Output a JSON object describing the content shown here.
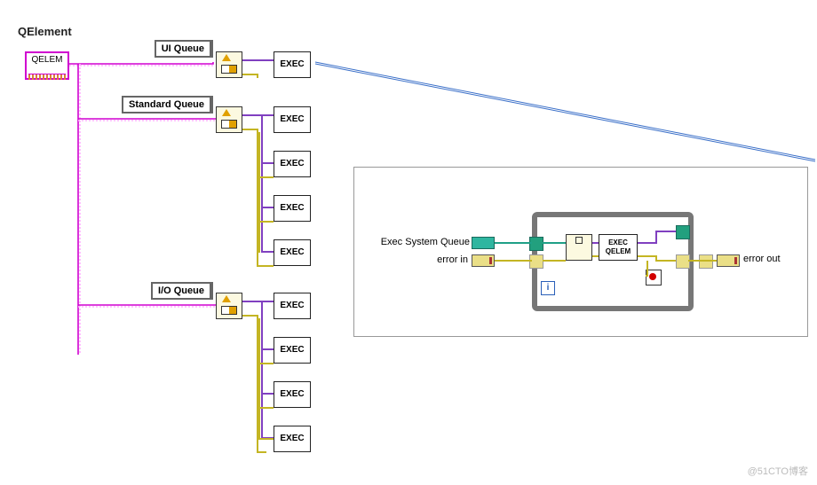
{
  "source": {
    "title_label": "QElement",
    "terminal_text": "QELEM"
  },
  "queues": {
    "ui": {
      "label": "UI Queue",
      "exec_count": 1
    },
    "standard": {
      "label": "Standard Queue",
      "exec_count": 4
    },
    "io": {
      "label": "I/O Queue",
      "exec_count": 4
    }
  },
  "exec_label": "EXEC",
  "detail": {
    "queue_label": "Exec System Queue",
    "error_in_label": "error in",
    "error_out_label": "error out",
    "exec_box_line1": "EXEC",
    "exec_box_line2": "QELEM",
    "loop_counter": "i"
  },
  "watermark": "@51CTO博客"
}
